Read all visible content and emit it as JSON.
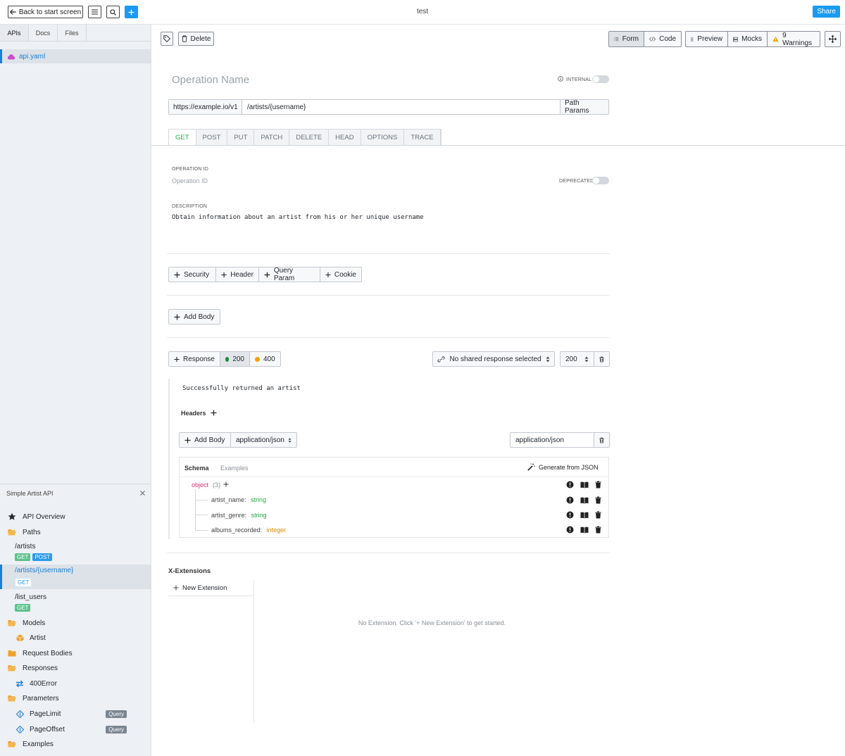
{
  "topbar": {
    "back_label": "Back to start screen",
    "title": "test",
    "share_label": "Share"
  },
  "sidebar": {
    "tabs": [
      "APIs",
      "Docs",
      "Files"
    ],
    "file": "api.yaml",
    "panel_title": "Simple Artist API",
    "tree": {
      "overview": "API Overview",
      "paths": "Paths",
      "path_artists": "/artists",
      "path_artists_username": "/artists/{username}",
      "path_list_users": "/list_users",
      "models": "Models",
      "model_artist": "Artist",
      "request_bodies": "Request Bodies",
      "responses": "Responses",
      "response_400": "400Error",
      "parameters": "Parameters",
      "param_pagelimit": "PageLimit",
      "param_pageoffset": "PageOffset",
      "examples": "Examples"
    },
    "badges": {
      "get": "GET",
      "post": "POST",
      "query": "Query"
    }
  },
  "toolbar": {
    "delete_label": "Delete",
    "form_label": "Form",
    "code_label": "Code",
    "preview_label": "Preview",
    "mocks_label": "Mocks",
    "warnings_label": "9 Warnings"
  },
  "operation": {
    "name_placeholder": "Operation Name",
    "internal_label": "INTERNAL",
    "base_url": "https://example.io/v1",
    "path": "/artists/{username}",
    "path_params_label": "Path Params",
    "methods": [
      "GET",
      "POST",
      "PUT",
      "PATCH",
      "DELETE",
      "HEAD",
      "OPTIONS",
      "TRACE"
    ],
    "operation_id_label": "OPERATION ID",
    "operation_id_placeholder": "Operation ID",
    "deprecated_label": "DEPRECATED",
    "description_label": "DESCRIPTION",
    "description": "Obtain information about an artist from his or her unique username"
  },
  "params": {
    "security": "Security",
    "header": "Header",
    "query_param": "Query Param",
    "cookie": "Cookie",
    "add_body": "Add Body"
  },
  "responses": {
    "add_label": "Response",
    "codes": [
      "200",
      "400"
    ],
    "shared_label": "No shared response selected",
    "selected_code": "200",
    "description": "Successfully returned an artist",
    "headers_label": "Headers",
    "add_body_label": "Add Body",
    "content_type_select": "application/json",
    "content_type_input": "application/json"
  },
  "schema": {
    "tab_schema": "Schema",
    "tab_examples": "Examples",
    "generate_label": "Generate from JSON",
    "root_type": "object",
    "root_count": "(3)",
    "properties": [
      {
        "name": "artist_name",
        "type": "string"
      },
      {
        "name": "artist_genre",
        "type": "string"
      },
      {
        "name": "albums_recorded",
        "type": "integer"
      }
    ]
  },
  "extensions": {
    "title": "X-Extensions",
    "new_label": "New Extension",
    "empty_text": "No Extension. Click '+ New Extension' to get started."
  },
  "colors": {
    "accent": "#1a9bf0",
    "get_green": "#28a745",
    "status_200": "#1e8c3a",
    "status_400": "#f0a500",
    "type_string": "#28a745",
    "type_integer": "#e08a00",
    "object_pink": "#e0306e"
  }
}
